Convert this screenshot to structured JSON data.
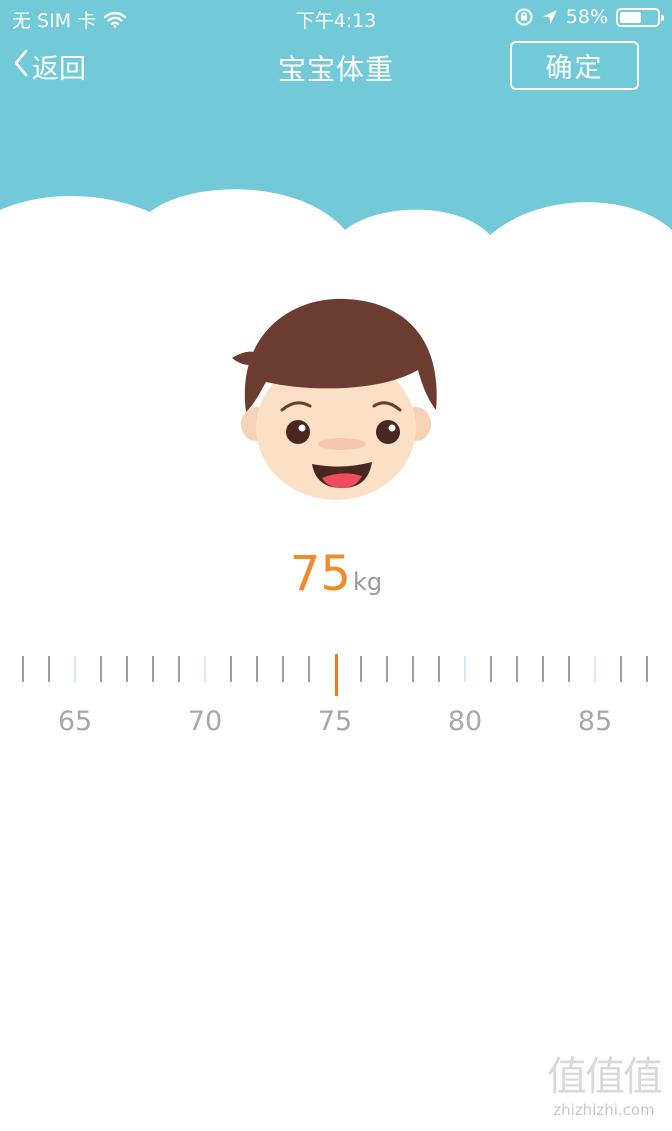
{
  "status_bar": {
    "carrier": "无 SIM 卡",
    "time": "下午4:13",
    "battery_percent": "58%",
    "battery_level": 0.58,
    "icons": [
      "wifi-icon",
      "lock-rotation-icon",
      "location-icon",
      "battery-icon"
    ]
  },
  "nav": {
    "back_label": "返回",
    "title": "宝宝体重",
    "confirm_label": "确定"
  },
  "weight": {
    "value": "75",
    "unit": "kg"
  },
  "ruler": {
    "labels": [
      "65",
      "70",
      "75",
      "80",
      "85"
    ],
    "selected": 75
  },
  "watermark": {
    "logo": "值值值",
    "text": "zhizhizhi.com"
  },
  "colors": {
    "header_bg": "#72c9d7",
    "accent": "#f08c28",
    "ruler_tick": "#9e9e9e",
    "label_gray": "#a8a8a8"
  }
}
